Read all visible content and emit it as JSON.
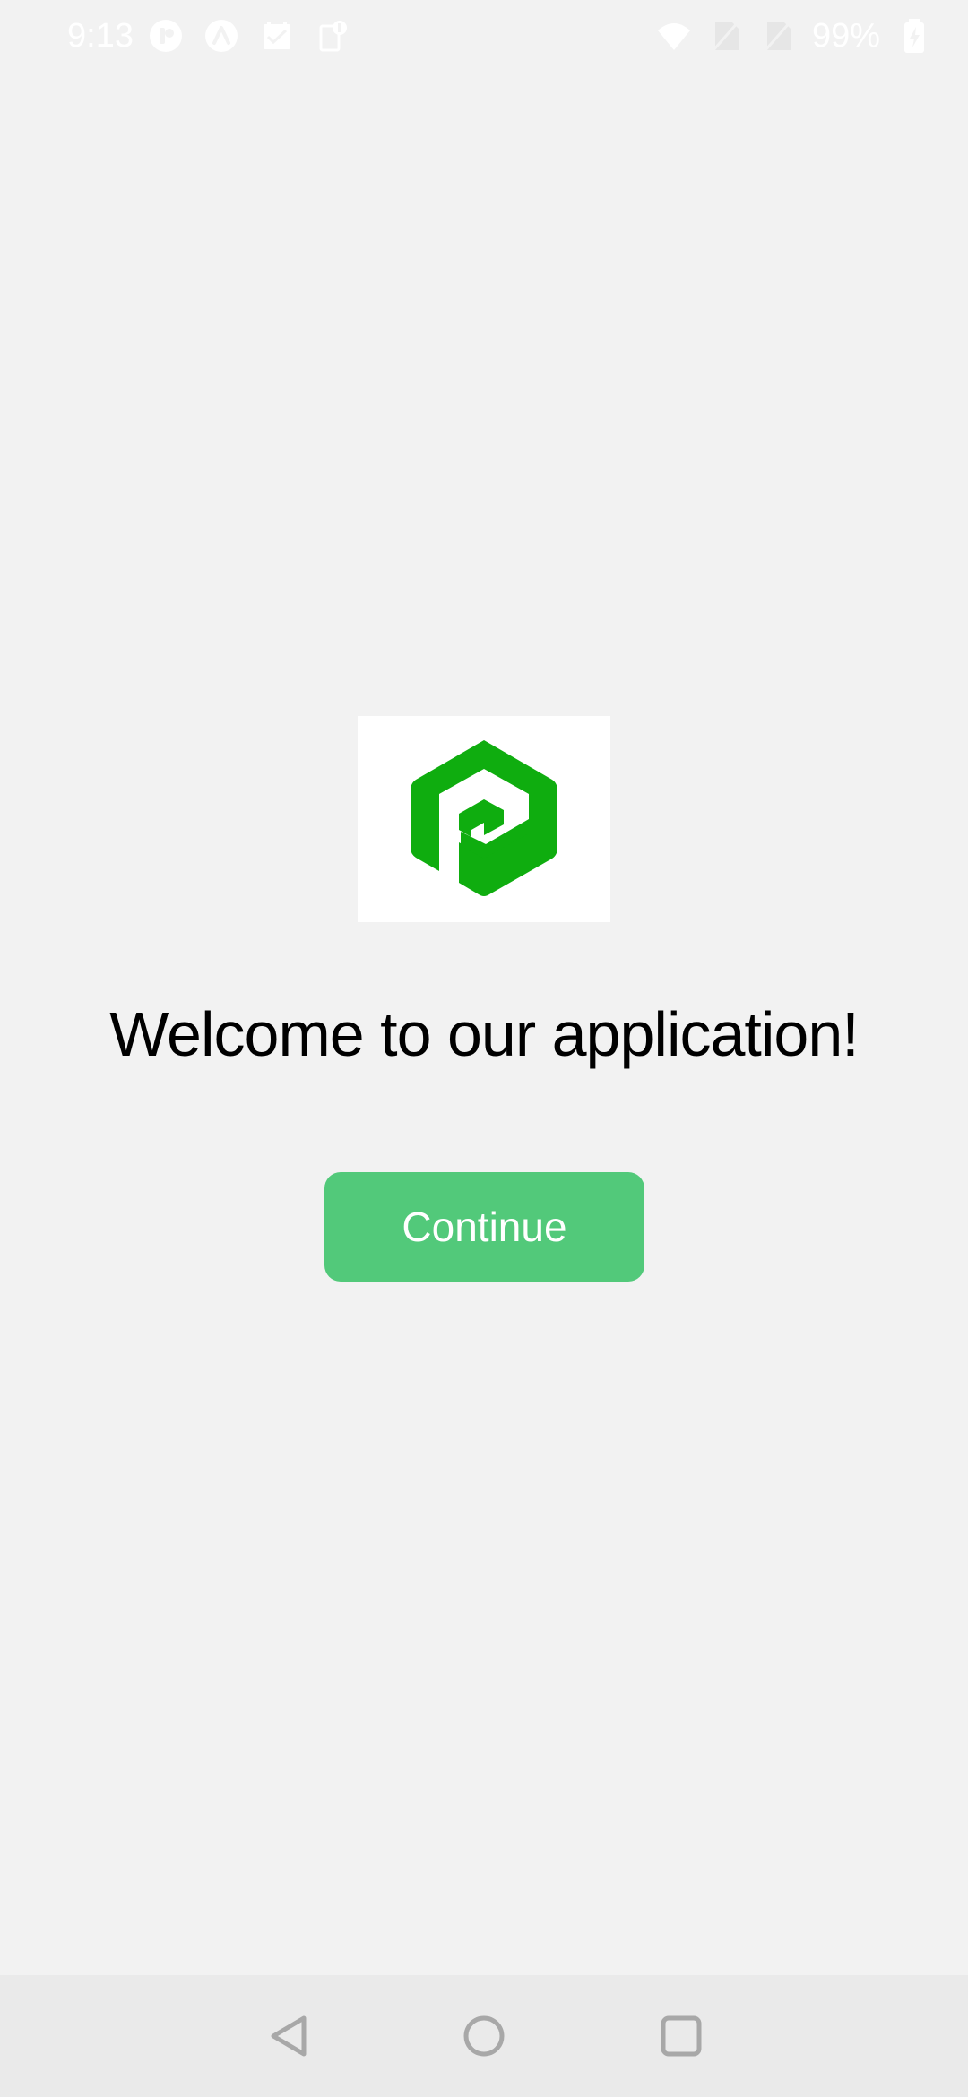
{
  "status_bar": {
    "time": "9:13",
    "battery_percent": "99%",
    "notification_icons": [
      "app-notification-icon",
      "arch-notification-icon",
      "calendar-notification-icon",
      "clipboard-notification-icon"
    ],
    "system_icons": [
      "wifi-icon",
      "no-sim-icon",
      "no-sim-icon",
      "battery-charging-icon"
    ]
  },
  "main": {
    "logo_icon": "brand-logo-hexagon",
    "welcome_text": "Welcome to our application!",
    "continue_label": "Continue"
  },
  "nav_bar": {
    "buttons": [
      "back-icon",
      "home-icon",
      "recents-icon"
    ]
  },
  "colors": {
    "background": "#f2f2f2",
    "brand_green": "#0fad0f",
    "button_green": "#52c97a",
    "nav_bar_bg": "#eaeaea"
  }
}
